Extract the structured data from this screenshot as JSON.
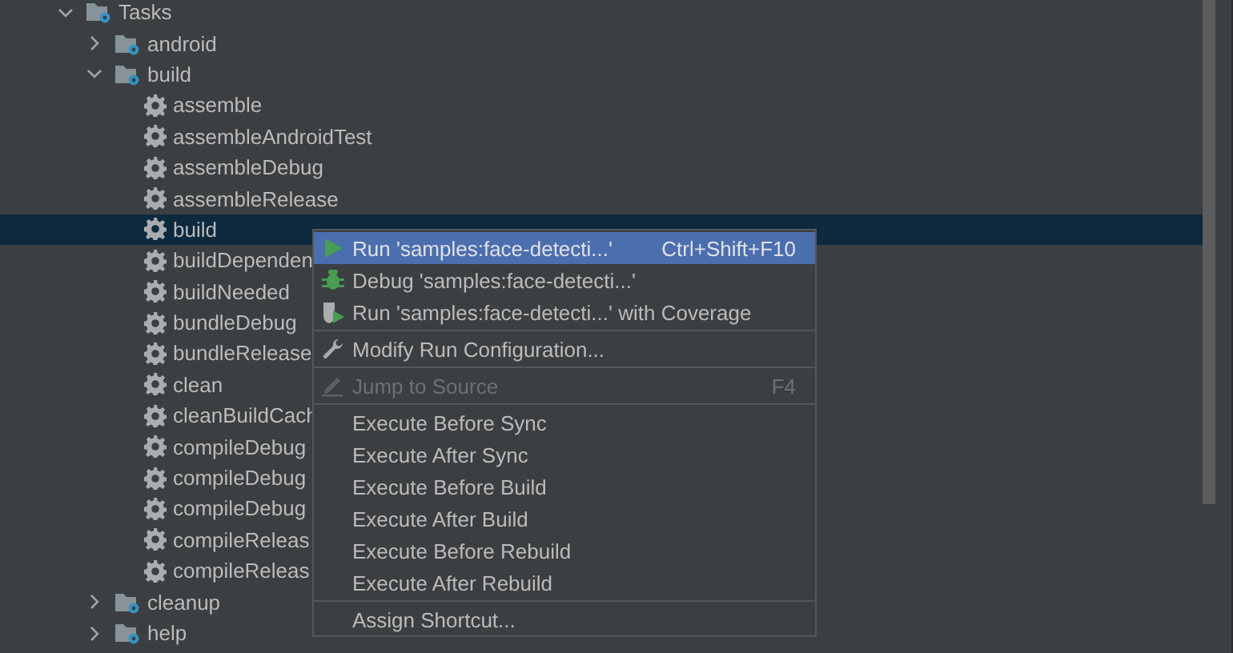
{
  "tree": [
    {
      "label": "Tasks",
      "kind": "folder",
      "expanded": true,
      "selected": false,
      "children": [
        {
          "label": "android",
          "kind": "folder",
          "expanded": false,
          "selected": false
        },
        {
          "label": "build",
          "kind": "folder",
          "expanded": true,
          "selected": false,
          "children": [
            {
              "label": "assemble",
              "kind": "task",
              "selected": false
            },
            {
              "label": "assembleAndroidTest",
              "kind": "task",
              "selected": false
            },
            {
              "label": "assembleDebug",
              "kind": "task",
              "selected": false
            },
            {
              "label": "assembleRelease",
              "kind": "task",
              "selected": false
            },
            {
              "label": "build",
              "kind": "task",
              "selected": true
            },
            {
              "label": "buildDependen",
              "kind": "task",
              "selected": false
            },
            {
              "label": "buildNeeded",
              "kind": "task",
              "selected": false
            },
            {
              "label": "bundleDebug",
              "kind": "task",
              "selected": false
            },
            {
              "label": "bundleRelease",
              "kind": "task",
              "selected": false
            },
            {
              "label": "clean",
              "kind": "task",
              "selected": false
            },
            {
              "label": "cleanBuildCach",
              "kind": "task",
              "selected": false
            },
            {
              "label": "compileDebug",
              "kind": "task",
              "selected": false
            },
            {
              "label": "compileDebug",
              "kind": "task",
              "selected": false
            },
            {
              "label": "compileDebug",
              "kind": "task",
              "selected": false
            },
            {
              "label": "compileReleas",
              "kind": "task",
              "selected": false
            },
            {
              "label": "compileReleas",
              "kind": "task",
              "selected": false
            }
          ]
        },
        {
          "label": "cleanup",
          "kind": "folder",
          "expanded": false,
          "selected": false
        },
        {
          "label": "help",
          "kind": "folder",
          "expanded": false,
          "selected": false
        }
      ]
    }
  ],
  "context_menu": [
    {
      "kind": "run",
      "label": "Run 'samples:face-detecti...'",
      "shortcut": "Ctrl+Shift+F10",
      "selected": true,
      "disabled": false
    },
    {
      "kind": "debug",
      "label": "Debug 'samples:face-detecti...'",
      "selected": false,
      "disabled": false
    },
    {
      "kind": "coverage",
      "label": "Run 'samples:face-detecti...' with Coverage",
      "selected": false,
      "disabled": false
    },
    {
      "kind": "separator"
    },
    {
      "kind": "modify",
      "label": "Modify Run Configuration...",
      "selected": false,
      "disabled": false
    },
    {
      "kind": "separator"
    },
    {
      "kind": "jump",
      "label": "Jump to Source",
      "shortcut": "F4",
      "selected": false,
      "disabled": true
    },
    {
      "kind": "separator"
    },
    {
      "kind": "plain",
      "label": "Execute Before Sync",
      "selected": false,
      "disabled": false
    },
    {
      "kind": "plain",
      "label": "Execute After Sync",
      "selected": false,
      "disabled": false
    },
    {
      "kind": "plain",
      "label": "Execute Before Build",
      "selected": false,
      "disabled": false
    },
    {
      "kind": "plain",
      "label": "Execute After Build",
      "selected": false,
      "disabled": false
    },
    {
      "kind": "plain",
      "label": "Execute Before Rebuild",
      "selected": false,
      "disabled": false
    },
    {
      "kind": "plain",
      "label": "Execute After Rebuild",
      "selected": false,
      "disabled": false
    },
    {
      "kind": "separator"
    },
    {
      "kind": "plain",
      "label": "Assign Shortcut...",
      "selected": false,
      "disabled": false
    }
  ]
}
